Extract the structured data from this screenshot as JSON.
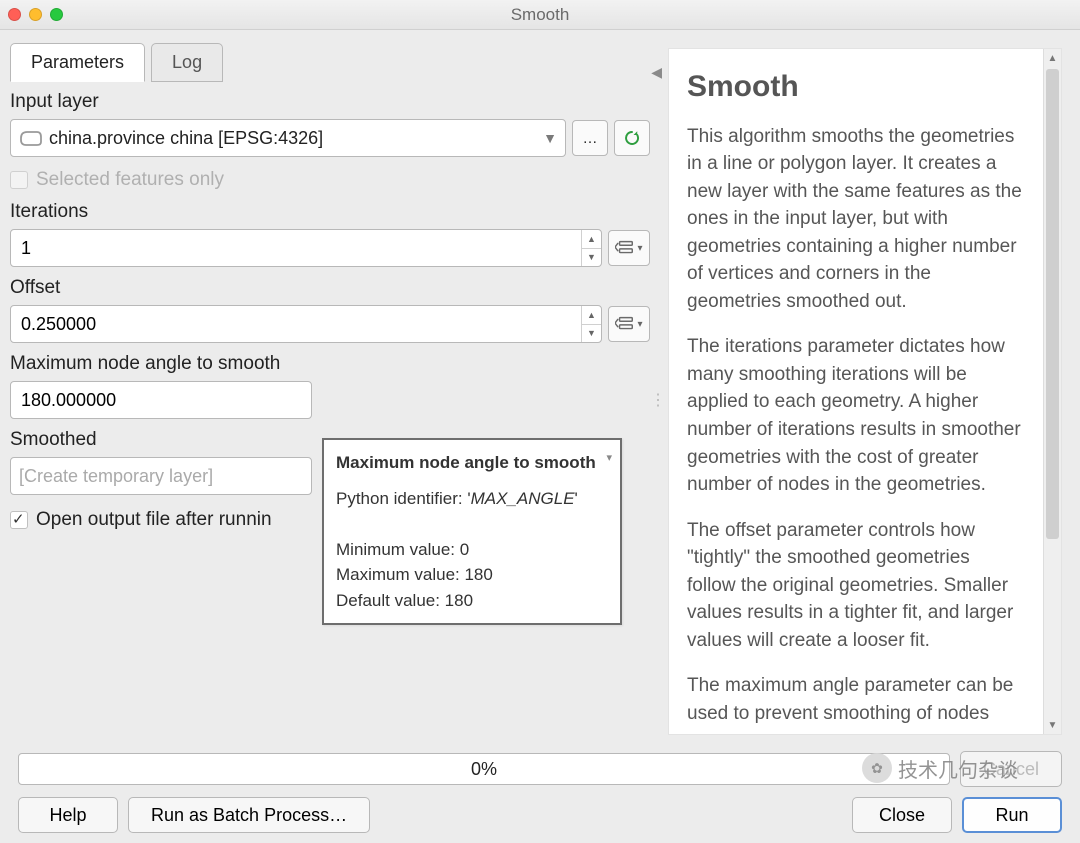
{
  "window": {
    "title": "Smooth"
  },
  "tabs": {
    "parameters": "Parameters",
    "log": "Log"
  },
  "fields": {
    "input_layer": {
      "label": "Input layer",
      "value": "china.province china [EPSG:4326]",
      "browse": "…",
      "selected_only": "Selected features only"
    },
    "iterations": {
      "label": "Iterations",
      "value": "1"
    },
    "offset": {
      "label": "Offset",
      "value": "0.250000"
    },
    "max_angle": {
      "label": "Maximum node angle to smooth",
      "value": "180.000000"
    },
    "smoothed": {
      "label": "Smoothed",
      "placeholder": "[Create temporary layer]"
    },
    "open_after": "Open output file after runnin"
  },
  "tooltip": {
    "title": "Maximum node angle to smooth",
    "py_label": "Python identifier: ",
    "py_id": "MAX_ANGLE",
    "min": "Minimum value: 0",
    "max": "Maximum value: 180",
    "def": "Default value: 180"
  },
  "help": {
    "title": "Smooth",
    "p1": "This algorithm smooths the geometries in a line or polygon layer. It creates a new layer with the same features as the ones in the input layer, but with geometries containing a higher number of vertices and corners in the geometries smoothed out.",
    "p2": "The iterations parameter dictates how many smoothing iterations will be applied to each geometry. A higher number of iterations results in smoother geometries with the cost of greater number of nodes in the geometries.",
    "p3": "The offset parameter controls how \"tightly\" the smoothed geometries follow the original geometries. Smaller values results in a tighter fit, and larger values will create a looser fit.",
    "p4": "The maximum angle parameter can be used to prevent smoothing of nodes"
  },
  "progress": {
    "text": "0%"
  },
  "buttons": {
    "cancel": "Cancel",
    "help": "Help",
    "batch": "Run as Batch Process…",
    "close": "Close",
    "run": "Run"
  },
  "watermark": "技术几句杂谈",
  "colors": {
    "accent": "#5a8fd6",
    "reload": "#2e9e3f"
  }
}
